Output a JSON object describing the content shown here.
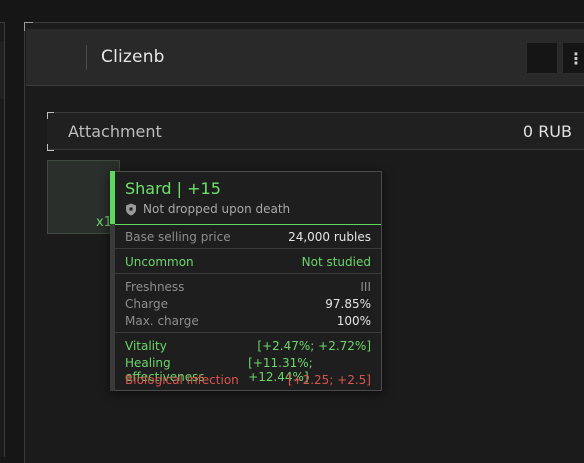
{
  "window": {
    "title": "Clizenb",
    "more_icon": "⋮"
  },
  "section": {
    "title": "Attachment",
    "value": "0 RUB"
  },
  "item": {
    "count": "x1"
  },
  "tooltip": {
    "name": "Shard | +15",
    "subtitle": "Not dropped upon death",
    "base_price_label": "Base selling price",
    "base_price_value": "24,000 rubles",
    "rarity": "Uncommon",
    "study_status": "Not studied",
    "freshness_label": "Freshness",
    "freshness_value": "III",
    "charge_label": "Charge",
    "charge_value": "97.85%",
    "max_charge_label": "Max. charge",
    "max_charge_value": "100%",
    "stats": [
      {
        "label": "Vitality",
        "value": "[+2.47%; +2.72%]"
      },
      {
        "label": "Healing effectiveness",
        "value": "[+11.31%; +12.44%]"
      },
      {
        "label": "Biological infection",
        "value": "[+2.25; +2.5]"
      }
    ]
  },
  "colors": {
    "accent_green": "#5fd75f",
    "text_green": "#6bd66b",
    "negative_red": "#d9534f"
  }
}
